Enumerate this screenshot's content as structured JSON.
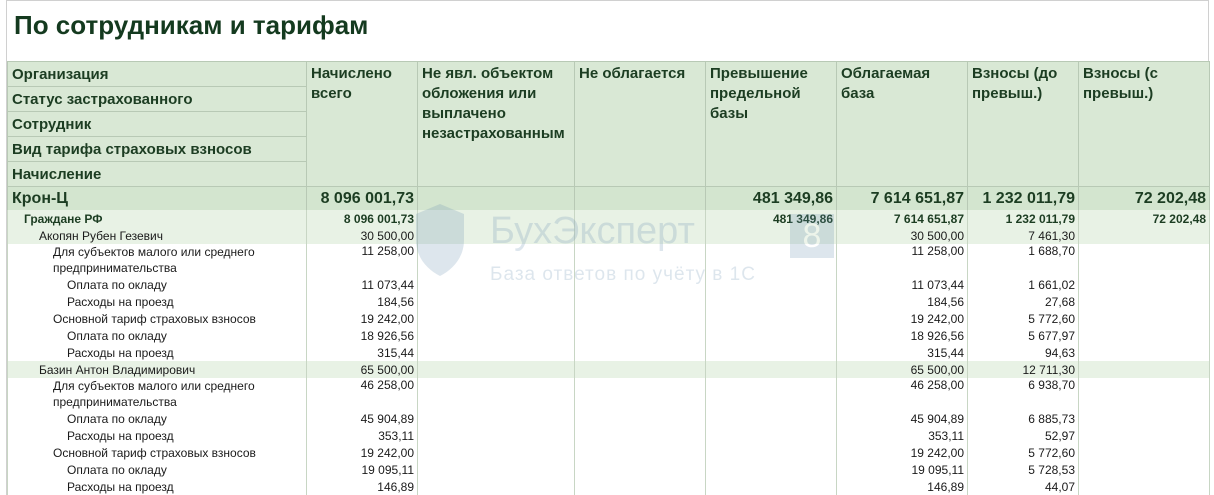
{
  "title": "По сотрудникам и тарифам",
  "header": {
    "groupings": [
      "Организация",
      "Статус застрахованного",
      "Сотрудник",
      "Вид тарифа страховых взносов",
      "Начисление"
    ],
    "columns": [
      "Начислено всего",
      "Не явл. объектом обложения или выплачено незастрахованным",
      "Не облагается",
      "Превышение предельной базы",
      "Облагаемая база",
      "Взносы (до превыш.)",
      "Взносы (с превыш.)"
    ]
  },
  "rows": [
    {
      "type": "org",
      "label": "Крон-Ц",
      "values": [
        "8 096 001,73",
        "",
        "",
        "481 349,86",
        "7 614 651,87",
        "1 232 011,79",
        "72 202,48"
      ]
    },
    {
      "type": "status",
      "label": "Граждане РФ",
      "values": [
        "8 096 001,73",
        "",
        "",
        "481 349,86",
        "7 614 651,87",
        "1 232 011,79",
        "72 202,48"
      ]
    },
    {
      "type": "employee",
      "label": "Акопян Рубен Гезевич",
      "values": [
        "30 500,00",
        "",
        "",
        "",
        "30 500,00",
        "7 461,30",
        ""
      ]
    },
    {
      "type": "tariff",
      "label": "Для субъектов малого или среднего предпринимательства",
      "values": [
        "11 258,00",
        "",
        "",
        "",
        "11 258,00",
        "1 688,70",
        ""
      ]
    },
    {
      "type": "accrual",
      "label": "Оплата по окладу",
      "values": [
        "11 073,44",
        "",
        "",
        "",
        "11 073,44",
        "1 661,02",
        ""
      ]
    },
    {
      "type": "accrual",
      "label": "Расходы на проезд",
      "values": [
        "184,56",
        "",
        "",
        "",
        "184,56",
        "27,68",
        ""
      ]
    },
    {
      "type": "tariff",
      "label": "Основной тариф страховых взносов",
      "values": [
        "19 242,00",
        "",
        "",
        "",
        "19 242,00",
        "5 772,60",
        ""
      ]
    },
    {
      "type": "accrual",
      "label": "Оплата по окладу",
      "values": [
        "18 926,56",
        "",
        "",
        "",
        "18 926,56",
        "5 677,97",
        ""
      ]
    },
    {
      "type": "accrual",
      "label": "Расходы на проезд",
      "values": [
        "315,44",
        "",
        "",
        "",
        "315,44",
        "94,63",
        ""
      ]
    },
    {
      "type": "employee",
      "label": "Базин Антон Владимирович",
      "values": [
        "65 500,00",
        "",
        "",
        "",
        "65 500,00",
        "12 711,30",
        ""
      ]
    },
    {
      "type": "tariff",
      "label": "Для субъектов малого или среднего предпринимательства",
      "values": [
        "46 258,00",
        "",
        "",
        "",
        "46 258,00",
        "6 938,70",
        ""
      ]
    },
    {
      "type": "accrual",
      "label": "Оплата по окладу",
      "values": [
        "45 904,89",
        "",
        "",
        "",
        "45 904,89",
        "6 885,73",
        ""
      ]
    },
    {
      "type": "accrual",
      "label": "Расходы на проезд",
      "values": [
        "353,11",
        "",
        "",
        "",
        "353,11",
        "52,97",
        ""
      ]
    },
    {
      "type": "tariff",
      "label": "Основной тариф страховых взносов",
      "values": [
        "19 242,00",
        "",
        "",
        "",
        "19 242,00",
        "5 772,60",
        ""
      ]
    },
    {
      "type": "accrual",
      "label": "Оплата по окладу",
      "values": [
        "19 095,11",
        "",
        "",
        "",
        "19 095,11",
        "5 728,53",
        ""
      ]
    },
    {
      "type": "accrual",
      "label": "Расходы на проезд",
      "values": [
        "146,89",
        "",
        "",
        "",
        "146,89",
        "44,07",
        ""
      ]
    }
  ],
  "watermark": {
    "title": "БухЭксперт",
    "badge": "8",
    "subtitle": "База ответов по учёту в 1С"
  }
}
